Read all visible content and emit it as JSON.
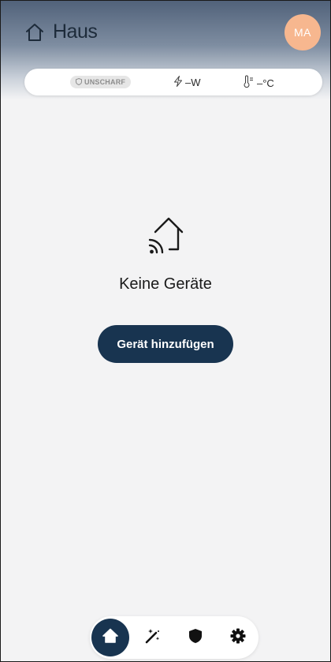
{
  "header": {
    "title": "Haus",
    "avatar_initials": "MA",
    "title_icon": "house-outline-icon",
    "avatar_color": "#f7b78f"
  },
  "status": {
    "alarm_label": "UNSCHARF",
    "alarm_icon": "shield-outline-icon",
    "power_value": "–W",
    "power_icon": "lightning-bolt-icon",
    "temperature_value": "–°C",
    "temperature_icon": "thermometer-icon"
  },
  "empty_state": {
    "icon": "smart-home-wifi-icon",
    "message": "Keine Geräte",
    "add_button_label": "Gerät hinzufügen",
    "button_color": "#183450"
  },
  "bottom_nav": {
    "items": [
      {
        "icon": "home-icon",
        "active": true
      },
      {
        "icon": "magic-wand-icon",
        "active": false
      },
      {
        "icon": "shield-icon",
        "active": false
      },
      {
        "icon": "gear-icon",
        "active": false
      }
    ]
  }
}
